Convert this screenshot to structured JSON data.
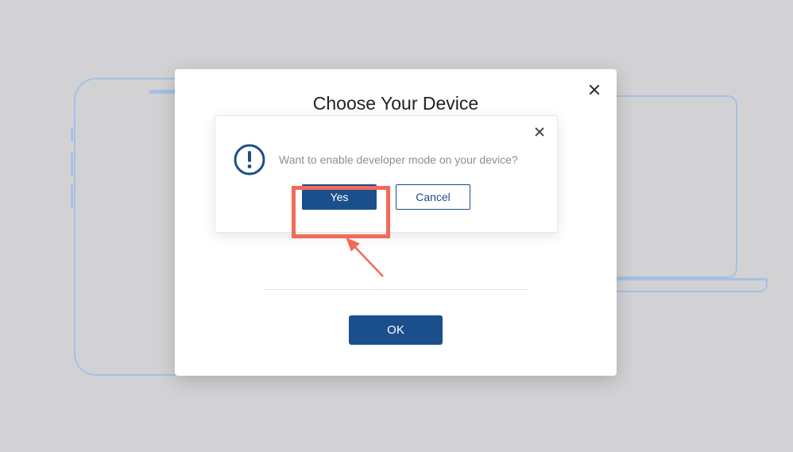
{
  "modal": {
    "title": "Choose Your Device",
    "close_label": "Close",
    "ok_label": "OK"
  },
  "confirm": {
    "message": "Want to enable developer mode on your device?",
    "yes_label": "Yes",
    "cancel_label": "Cancel",
    "close_label": "Close",
    "icon": "exclamation-circle"
  },
  "annotation": {
    "highlight_target": "yes-button",
    "color": "#f26a5a"
  }
}
